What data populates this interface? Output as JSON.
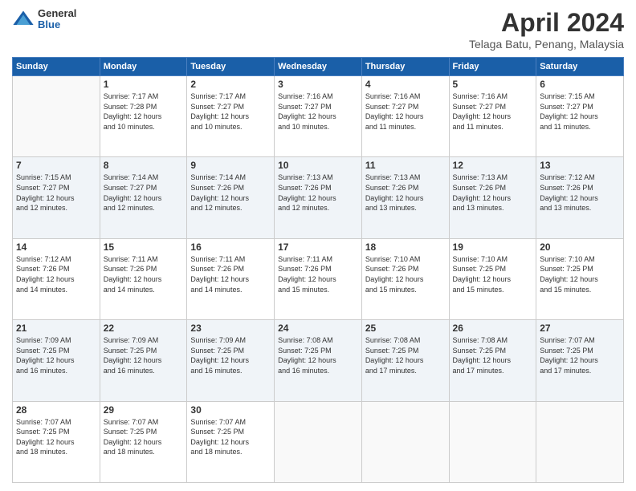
{
  "header": {
    "logo_general": "General",
    "logo_blue": "Blue",
    "month_title": "April 2024",
    "location": "Telaga Batu, Penang, Malaysia"
  },
  "weekdays": [
    "Sunday",
    "Monday",
    "Tuesday",
    "Wednesday",
    "Thursday",
    "Friday",
    "Saturday"
  ],
  "weeks": [
    [
      {
        "day": "",
        "info": ""
      },
      {
        "day": "1",
        "info": "Sunrise: 7:17 AM\nSunset: 7:28 PM\nDaylight: 12 hours\nand 10 minutes."
      },
      {
        "day": "2",
        "info": "Sunrise: 7:17 AM\nSunset: 7:27 PM\nDaylight: 12 hours\nand 10 minutes."
      },
      {
        "day": "3",
        "info": "Sunrise: 7:16 AM\nSunset: 7:27 PM\nDaylight: 12 hours\nand 10 minutes."
      },
      {
        "day": "4",
        "info": "Sunrise: 7:16 AM\nSunset: 7:27 PM\nDaylight: 12 hours\nand 11 minutes."
      },
      {
        "day": "5",
        "info": "Sunrise: 7:16 AM\nSunset: 7:27 PM\nDaylight: 12 hours\nand 11 minutes."
      },
      {
        "day": "6",
        "info": "Sunrise: 7:15 AM\nSunset: 7:27 PM\nDaylight: 12 hours\nand 11 minutes."
      }
    ],
    [
      {
        "day": "7",
        "info": "Sunrise: 7:15 AM\nSunset: 7:27 PM\nDaylight: 12 hours\nand 12 minutes."
      },
      {
        "day": "8",
        "info": "Sunrise: 7:14 AM\nSunset: 7:27 PM\nDaylight: 12 hours\nand 12 minutes."
      },
      {
        "day": "9",
        "info": "Sunrise: 7:14 AM\nSunset: 7:26 PM\nDaylight: 12 hours\nand 12 minutes."
      },
      {
        "day": "10",
        "info": "Sunrise: 7:13 AM\nSunset: 7:26 PM\nDaylight: 12 hours\nand 12 minutes."
      },
      {
        "day": "11",
        "info": "Sunrise: 7:13 AM\nSunset: 7:26 PM\nDaylight: 12 hours\nand 13 minutes."
      },
      {
        "day": "12",
        "info": "Sunrise: 7:13 AM\nSunset: 7:26 PM\nDaylight: 12 hours\nand 13 minutes."
      },
      {
        "day": "13",
        "info": "Sunrise: 7:12 AM\nSunset: 7:26 PM\nDaylight: 12 hours\nand 13 minutes."
      }
    ],
    [
      {
        "day": "14",
        "info": "Sunrise: 7:12 AM\nSunset: 7:26 PM\nDaylight: 12 hours\nand 14 minutes."
      },
      {
        "day": "15",
        "info": "Sunrise: 7:11 AM\nSunset: 7:26 PM\nDaylight: 12 hours\nand 14 minutes."
      },
      {
        "day": "16",
        "info": "Sunrise: 7:11 AM\nSunset: 7:26 PM\nDaylight: 12 hours\nand 14 minutes."
      },
      {
        "day": "17",
        "info": "Sunrise: 7:11 AM\nSunset: 7:26 PM\nDaylight: 12 hours\nand 15 minutes."
      },
      {
        "day": "18",
        "info": "Sunrise: 7:10 AM\nSunset: 7:26 PM\nDaylight: 12 hours\nand 15 minutes."
      },
      {
        "day": "19",
        "info": "Sunrise: 7:10 AM\nSunset: 7:25 PM\nDaylight: 12 hours\nand 15 minutes."
      },
      {
        "day": "20",
        "info": "Sunrise: 7:10 AM\nSunset: 7:25 PM\nDaylight: 12 hours\nand 15 minutes."
      }
    ],
    [
      {
        "day": "21",
        "info": "Sunrise: 7:09 AM\nSunset: 7:25 PM\nDaylight: 12 hours\nand 16 minutes."
      },
      {
        "day": "22",
        "info": "Sunrise: 7:09 AM\nSunset: 7:25 PM\nDaylight: 12 hours\nand 16 minutes."
      },
      {
        "day": "23",
        "info": "Sunrise: 7:09 AM\nSunset: 7:25 PM\nDaylight: 12 hours\nand 16 minutes."
      },
      {
        "day": "24",
        "info": "Sunrise: 7:08 AM\nSunset: 7:25 PM\nDaylight: 12 hours\nand 16 minutes."
      },
      {
        "day": "25",
        "info": "Sunrise: 7:08 AM\nSunset: 7:25 PM\nDaylight: 12 hours\nand 17 minutes."
      },
      {
        "day": "26",
        "info": "Sunrise: 7:08 AM\nSunset: 7:25 PM\nDaylight: 12 hours\nand 17 minutes."
      },
      {
        "day": "27",
        "info": "Sunrise: 7:07 AM\nSunset: 7:25 PM\nDaylight: 12 hours\nand 17 minutes."
      }
    ],
    [
      {
        "day": "28",
        "info": "Sunrise: 7:07 AM\nSunset: 7:25 PM\nDaylight: 12 hours\nand 18 minutes."
      },
      {
        "day": "29",
        "info": "Sunrise: 7:07 AM\nSunset: 7:25 PM\nDaylight: 12 hours\nand 18 minutes."
      },
      {
        "day": "30",
        "info": "Sunrise: 7:07 AM\nSunset: 7:25 PM\nDaylight: 12 hours\nand 18 minutes."
      },
      {
        "day": "",
        "info": ""
      },
      {
        "day": "",
        "info": ""
      },
      {
        "day": "",
        "info": ""
      },
      {
        "day": "",
        "info": ""
      }
    ]
  ]
}
